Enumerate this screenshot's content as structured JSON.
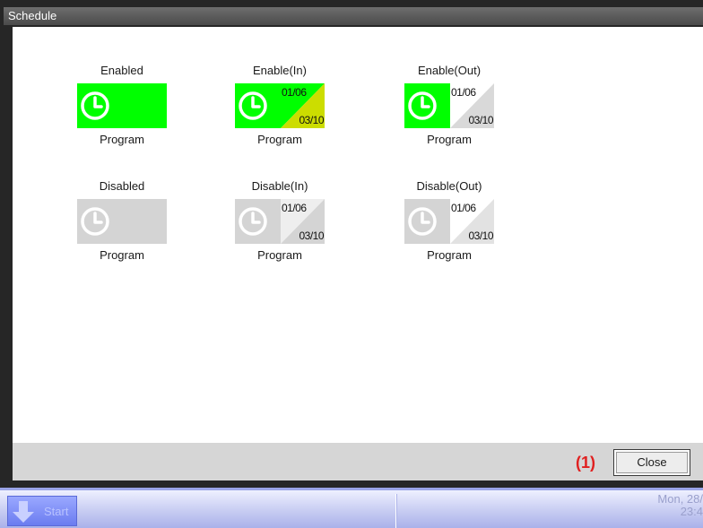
{
  "window": {
    "title": "Schedule"
  },
  "rows": [
    [
      {
        "label": "Enabled",
        "name": "Program",
        "date_start": "",
        "date_end": "",
        "variant": "enabled"
      },
      {
        "label": "Enable(In)",
        "name": "Program",
        "date_start": "01/06",
        "date_end": "03/10",
        "variant": "enable-in"
      },
      {
        "label": "Enable(Out)",
        "name": "Program",
        "date_start": "01/06",
        "date_end": "03/10",
        "variant": "enable-out"
      }
    ],
    [
      {
        "label": "Disabled",
        "name": "Program",
        "date_start": "",
        "date_end": "",
        "variant": "disabled"
      },
      {
        "label": "Disable(In)",
        "name": "Program",
        "date_start": "01/06",
        "date_end": "03/10",
        "variant": "disable-in"
      },
      {
        "label": "Disable(Out)",
        "name": "Program",
        "date_start": "01/06",
        "date_end": "03/10",
        "variant": "disable-out"
      }
    ]
  ],
  "footer": {
    "callout": "(1)",
    "close_label": "Close"
  },
  "taskbar": {
    "start_label": "Start",
    "date": "Mon, 28/",
    "time": "23:4"
  },
  "colors": {
    "enabled_green": "#00ff00",
    "in_range_yellow": "#ccdd00",
    "disabled_gray": "#d4d4d4",
    "light_gray": "#eeeeee",
    "callout_red": "#e02020"
  },
  "icons": {
    "schedule": "clock-icon",
    "start": "down-arrow-icon"
  }
}
